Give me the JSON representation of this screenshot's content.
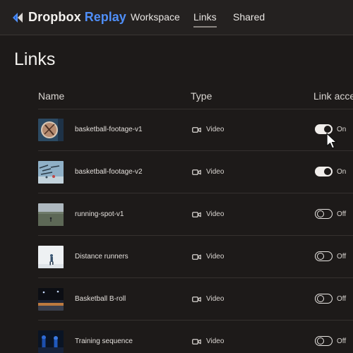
{
  "brand": {
    "name": "Dropbox",
    "product": "Replay"
  },
  "nav": [
    {
      "label": "Workspace",
      "active": false
    },
    {
      "label": "Links",
      "active": true
    },
    {
      "label": "Shared",
      "active": false
    }
  ],
  "page": {
    "title": "Links"
  },
  "columns": {
    "name": "Name",
    "type": "Type",
    "access": "Link acce"
  },
  "rows": [
    {
      "name": "basketball-footage-v1",
      "type": "Video",
      "access": "On",
      "enabled": true,
      "thumb": "basketball-closeup"
    },
    {
      "name": "basketball-footage-v2",
      "type": "Video",
      "access": "On",
      "enabled": true,
      "thumb": "basketball-team"
    },
    {
      "name": "running-spot-v1",
      "type": "Video",
      "access": "Off",
      "enabled": false,
      "thumb": "runner-field"
    },
    {
      "name": "Distance runners",
      "type": "Video",
      "access": "Off",
      "enabled": false,
      "thumb": "runner-sky"
    },
    {
      "name": "Basketball B-roll",
      "type": "Video",
      "access": "Off",
      "enabled": false,
      "thumb": "arena-lights"
    },
    {
      "name": "Training sequence",
      "type": "Video",
      "access": "Off",
      "enabled": false,
      "thumb": "athletes-blue"
    }
  ],
  "colors": {
    "accent": "#4f8ef7",
    "background": "#1d1a19",
    "topbar": "#242120"
  }
}
